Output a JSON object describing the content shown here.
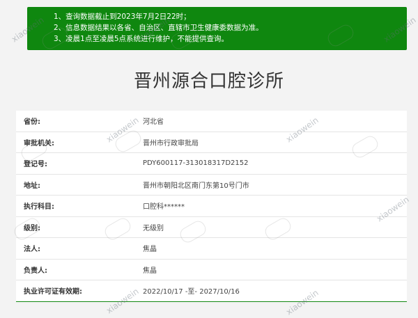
{
  "notice": {
    "lines": [
      "1、查询数据截止到2023年7月2日22时；",
      "2、信息数据结果以各省、自治区、直辖市卫生健康委数据为准。",
      "3、凌晨1点至凌晨5点系统进行维护，不能提供查询。"
    ]
  },
  "title": "晋州源合口腔诊所",
  "rows": [
    {
      "label": "省份:",
      "value": "河北省"
    },
    {
      "label": "审批机关:",
      "value": "晋州市行政审批局"
    },
    {
      "label": "登记号:",
      "value": "PDY600117-313018317D2152"
    },
    {
      "label": "地址:",
      "value": "晋州市朝阳北区南门东第10号门市"
    },
    {
      "label": "执行科目:",
      "value": "口腔科******"
    },
    {
      "label": "级别:",
      "value": "无级别"
    },
    {
      "label": "法人:",
      "value": "焦晶"
    },
    {
      "label": "负责人:",
      "value": "焦晶"
    },
    {
      "label": "执业许可证有效期:",
      "value": "2022/10/17 -至- 2027/10/16"
    }
  ],
  "watermark": {
    "text": "xiaowein"
  }
}
